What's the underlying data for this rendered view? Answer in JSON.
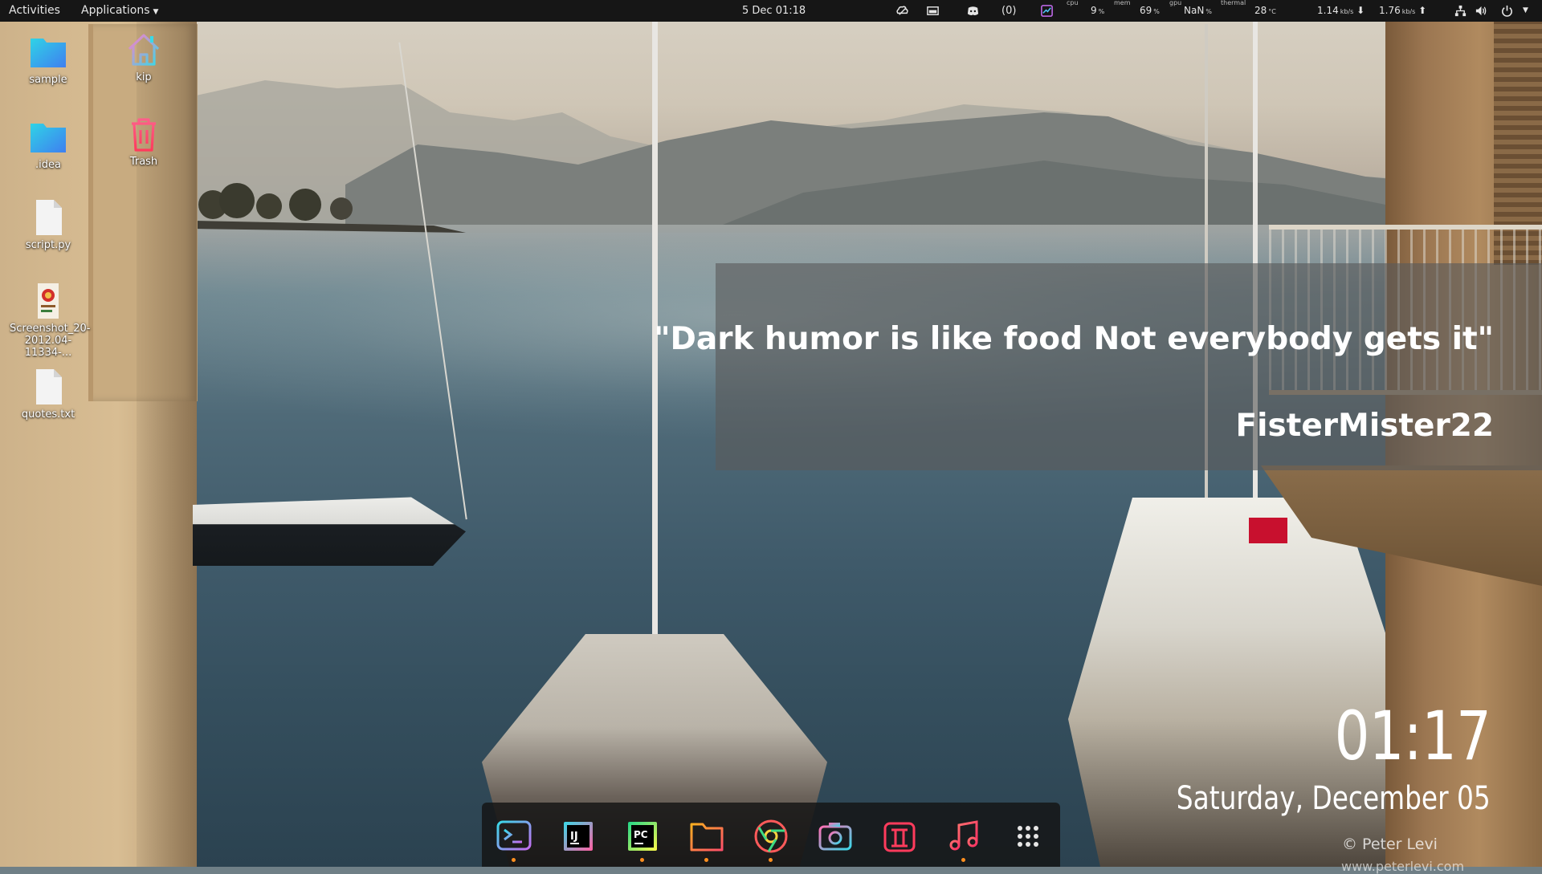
{
  "topbar": {
    "activities_label": "Activities",
    "applications_label": "Applications",
    "clock": "5 Dec  01:18",
    "notifications_count": "(0)",
    "stats": {
      "cpu_caption": "cpu",
      "cpu_value": "9",
      "cpu_unit": "%",
      "mem_caption": "mem",
      "mem_value": "69",
      "mem_unit": "%",
      "gpu_caption": "gpu",
      "gpu_value": "NaN",
      "gpu_unit": "%",
      "thermal_caption": "thermal",
      "thermal_value": "28",
      "thermal_unit": "°C",
      "down_value": "1.14",
      "down_unit": "kb/s",
      "up_value": "1.76",
      "up_unit": "kb/s"
    },
    "icons": [
      "weather-icon",
      "screen-icon",
      "discord-icon",
      "chart-icon",
      "network-icon",
      "volume-icon",
      "power-icon"
    ]
  },
  "desktop_icons": [
    {
      "label": "sample",
      "icon": "folder-icon"
    },
    {
      "label": "kip",
      "icon": "home-icon"
    },
    {
      "label": ".idea",
      "icon": "folder-icon"
    },
    {
      "label": "Trash",
      "icon": "trash-icon"
    },
    {
      "label": "script.py",
      "icon": "file-icon"
    },
    {
      "label": "Screenshot_20-2012.04-11334-...",
      "label_line1": "Screenshot_20-",
      "label_line2": "2012.04-11334-...",
      "icon": "image-file-icon"
    },
    {
      "label": "quotes.txt",
      "icon": "file-icon"
    }
  ],
  "quote": {
    "text": "\"Dark humor is like food Not everybody gets it\"",
    "author": "FisterMister22"
  },
  "clock_widget": {
    "time": "01:17",
    "date": "Saturday, December 05"
  },
  "wallpaper": {
    "credit": "© Peter Levi",
    "credit_url": "www.peterlevi.com"
  },
  "dock": {
    "items": [
      {
        "name": "terminal",
        "icon": "terminal-icon",
        "running": true
      },
      {
        "name": "intellij",
        "icon": "intellij-icon",
        "running": false
      },
      {
        "name": "pycharm",
        "icon": "pycharm-icon",
        "running": true
      },
      {
        "name": "files",
        "icon": "folder-icon",
        "running": true
      },
      {
        "name": "chrome",
        "icon": "chrome-icon",
        "running": true
      },
      {
        "name": "screenshot",
        "icon": "camera-icon",
        "running": false
      },
      {
        "name": "anydo",
        "icon": "app-icon",
        "running": false
      },
      {
        "name": "music",
        "icon": "music-icon",
        "running": true
      },
      {
        "name": "show-apps",
        "icon": "grid-icon",
        "running": false
      }
    ]
  },
  "colors": {
    "topbar_bg": "#161616",
    "running_dot": "#ff8f1f",
    "folder_cyan": "#2fd3e6",
    "folder_blue": "#3f7ff0"
  }
}
